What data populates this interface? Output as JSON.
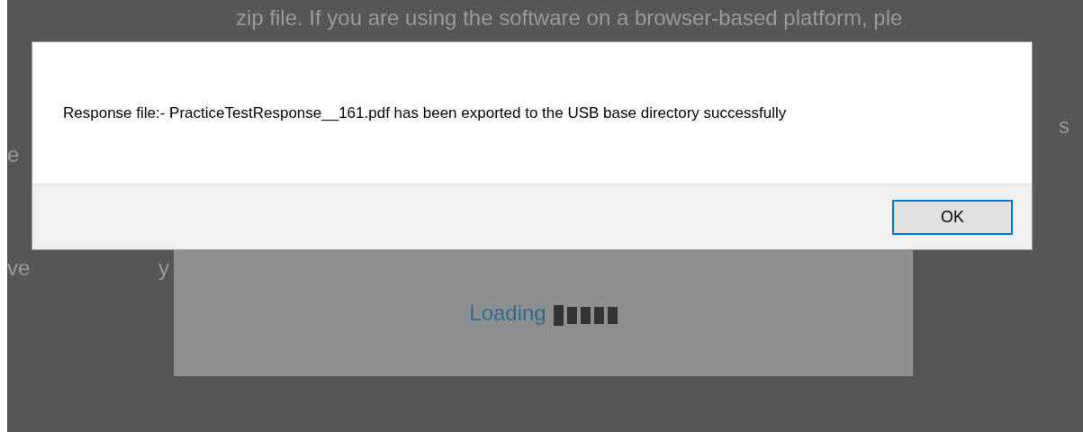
{
  "background_page": {
    "text_fragments": [
      "zip file. If you are using the software on a browser-based platform, ple",
      "s",
      "e",
      "ve",
      "y"
    ]
  },
  "loading": {
    "label": "Loading"
  },
  "dialog": {
    "message": "Response file:- PracticeTestResponse__161.pdf has been exported to the USB base directory successfully",
    "button": "OK"
  }
}
